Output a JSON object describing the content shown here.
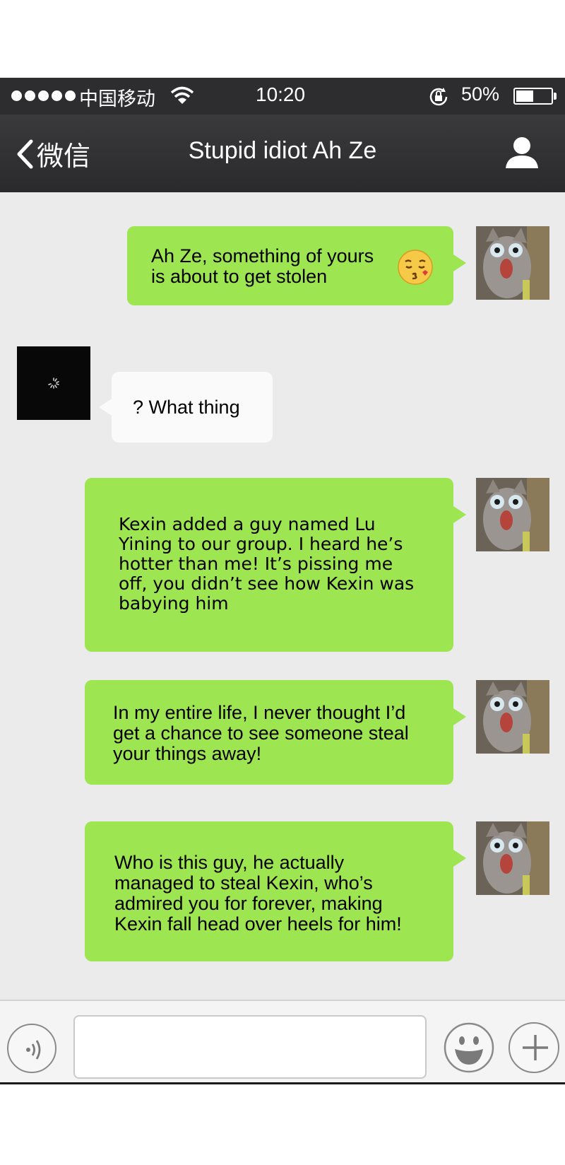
{
  "status_bar": {
    "signal_dots": 5,
    "carrier": "中国移动",
    "time": "10:20",
    "battery_percent": "50%",
    "battery_level": 0.5
  },
  "nav": {
    "back_label": "微信",
    "title": "Stupid idiot Ah Ze"
  },
  "messages": [
    {
      "sender": "me",
      "lines": [
        "Ah Ze, something of yours",
        "is about to get stolen"
      ],
      "emoji": "kissing-face-icon"
    },
    {
      "sender": "them",
      "lines": [
        "? What thing"
      ]
    },
    {
      "sender": "me",
      "lines": [
        "Kexin added a guy named Lu",
        "Yining to our group. I heard he’s",
        "hotter than me! It’s pissing me",
        "off, you didn’t see how Kexin was",
        "babying him"
      ]
    },
    {
      "sender": "me",
      "lines": [
        "In my entire life, I never thought I’d",
        "get a chance to see someone steal",
        "your things away!"
      ]
    },
    {
      "sender": "me",
      "lines": [
        "Who is this guy, he actually",
        "managed to steal Kexin, who’s",
        "admired you for forever, making",
        "Kexin fall head over heels for him!"
      ]
    }
  ],
  "input_bar": {
    "placeholder": ""
  },
  "colors": {
    "my_bubble": "#9ee552",
    "their_bubble": "#fafafa",
    "chat_background": "#ebebeb",
    "header": "#2d2d2f"
  }
}
